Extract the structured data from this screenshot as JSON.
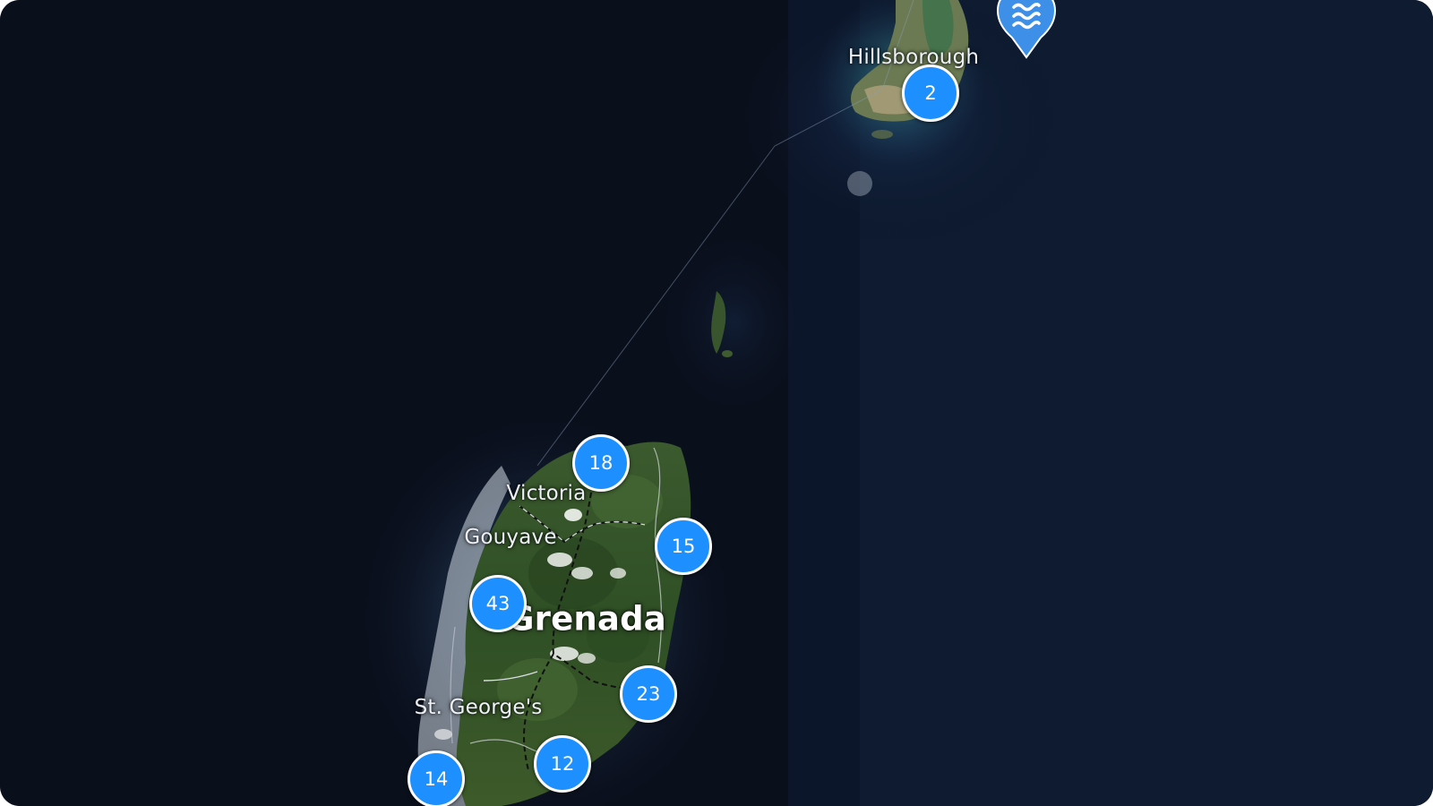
{
  "map": {
    "ocean_color": "#0a0f1c",
    "cluster_color": "#1e8fff",
    "pin_color": "#3d8fe8",
    "labels": {
      "hillsborough": "Hillsborough",
      "victoria": "Victoria",
      "gouyave": "Gouyave",
      "grenada": "Grenada",
      "st_georges": "St. George's"
    },
    "clusters": {
      "hillsborough": "2",
      "victoria": "18",
      "east": "15",
      "west": "43",
      "southeast": "23",
      "south": "12",
      "southwest": "14"
    },
    "water_pin": {
      "icon": "water-waves-icon"
    }
  }
}
